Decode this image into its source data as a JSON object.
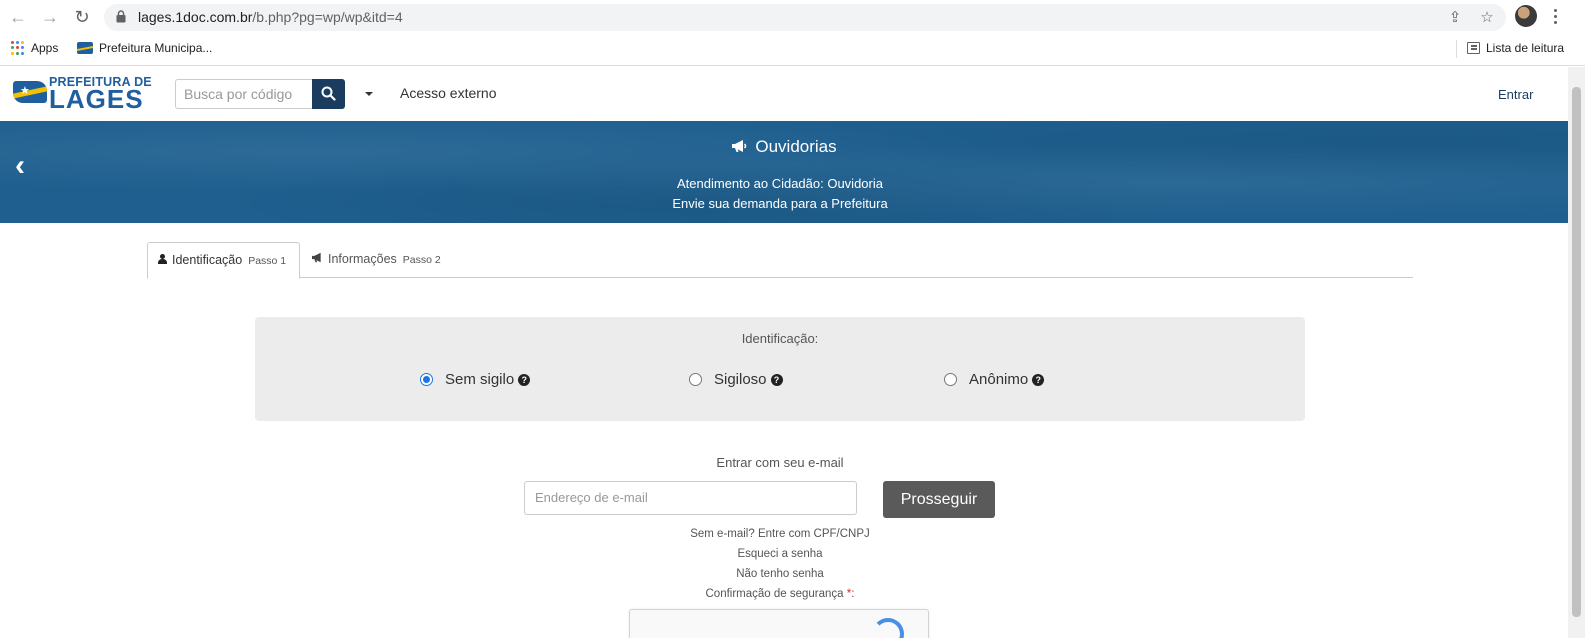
{
  "browser": {
    "url_host": "lages.1doc.com.br",
    "url_path": "/b.php?pg=wp/wp&itd=4",
    "bookmarks": [
      {
        "label": "Apps"
      },
      {
        "label": "Prefeitura Municipa..."
      }
    ],
    "reading_list_label": "Lista de leitura"
  },
  "header": {
    "logo_line1": "PREFEITURA DE",
    "logo_line2": "LAGES",
    "search_placeholder": "Busca por código",
    "external_access_label": "Acesso externo",
    "login_label": "Entrar"
  },
  "banner": {
    "title": "Ouvidorias",
    "subtitle1": "Atendimento ao Cidadão: Ouvidoria",
    "subtitle2": "Envie sua demanda para a Prefeitura"
  },
  "tabs": [
    {
      "label": "Identificação",
      "step": "Passo 1",
      "active": true
    },
    {
      "label": "Informações",
      "step": "Passo 2",
      "active": false
    }
  ],
  "identification": {
    "title": "Identificação:",
    "options": [
      {
        "label": "Sem sigilo",
        "checked": true
      },
      {
        "label": "Sigiloso",
        "checked": false
      },
      {
        "label": "Anônimo",
        "checked": false
      }
    ]
  },
  "login_form": {
    "label": "Entrar com seu e-mail",
    "email_placeholder": "Endereço de e-mail",
    "proceed_label": "Prosseguir",
    "no_email_link": "Sem e-mail? Entre com CPF/CNPJ",
    "forgot_link": "Esqueci a senha",
    "no_password_link": "Não tenho senha",
    "security_label": "Confirmação de segurança",
    "required_mark": "*",
    "security_suffix": ":"
  },
  "colors": {
    "banner": "#1e5f8f",
    "header_button": "#1a3c5e",
    "proceed_button": "#5a5a5a",
    "panel_bg": "#ececec"
  }
}
